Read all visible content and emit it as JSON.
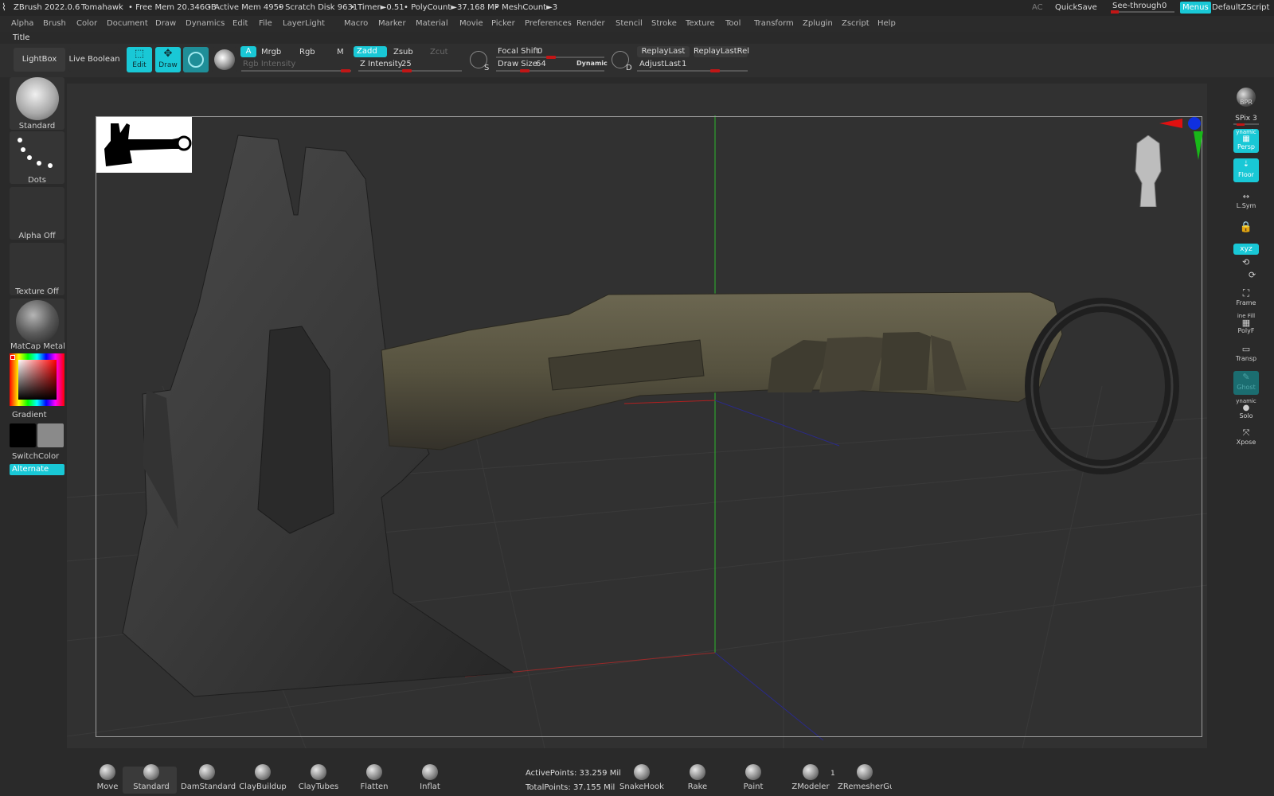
{
  "topbar": {
    "app": "ZBrush 2022.0.6",
    "doc": "Tomahawk",
    "free_mem": "• Free Mem 20.346GB",
    "active_mem": "• Active Mem 4959",
    "scratch": "• Scratch Disk 9631",
    "timer": "• Timer►0.51",
    "polycount": "• PolyCount►37.168 MP",
    "meshcount": "• MeshCount►3",
    "ac": "AC",
    "quicksave": "QuickSave",
    "see_through_label": "See-through",
    "see_through_value": "0",
    "menus": "Menus",
    "script": "DefaultZScript"
  },
  "menubar": [
    "Alpha",
    "Brush",
    "Color",
    "Document",
    "Draw",
    "Dynamics",
    "Edit",
    "File",
    "Layer",
    "Light",
    "Macro",
    "Marker",
    "Material",
    "Movie",
    "Picker",
    "Preferences",
    "Render",
    "Stencil",
    "Stroke",
    "Texture",
    "Tool",
    "Transform",
    "Zplugin",
    "Zscript",
    "Help"
  ],
  "titlebar": {
    "title": "Title"
  },
  "toolbar": {
    "lightbox": "LightBox",
    "live_boolean": "Live Boolean",
    "edit": "Edit",
    "draw": "Draw",
    "a": "A",
    "mrgb": "Mrgb",
    "rgb": "Rgb",
    "m": "M",
    "rgb_intensity": "Rgb Intensity",
    "zadd": "Zadd",
    "zsub": "Zsub",
    "zcut": "Zcut",
    "z_intensity_label": "Z Intensity",
    "z_intensity_value": "25",
    "focal_shift_label": "Focal Shift",
    "focal_shift_value": "0",
    "draw_size_label": "Draw Size",
    "draw_size_value": "64",
    "dynamic": "Dynamic",
    "replay_last": "ReplayLast",
    "replay_last_rel": "ReplayLastRel",
    "adjust_last_label": "AdjustLast",
    "adjust_last_value": "1",
    "s": "S",
    "d": "D"
  },
  "leftshelf": {
    "brush": "Standard",
    "stroke": "Dots",
    "alpha": "Alpha Off",
    "texture": "Texture Off",
    "material": "MatCap MetalC",
    "gradient": "Gradient",
    "switch_color": "SwitchColor",
    "alternate": "Alternate"
  },
  "rightshelf": {
    "bpr": "BPR",
    "spix_label": "SPix",
    "spix_value": "3",
    "dynamic": "ynamic",
    "persp": "Persp",
    "floor": "Floor",
    "lsym": "L.Sym",
    "xyz": "xyz",
    "frame": "Frame",
    "line_fill": "ine Fill",
    "polyf": "PolyF",
    "transp": "Transp",
    "ghost": "Ghost",
    "dynamic2": "ynamic",
    "solo": "Solo",
    "xpose": "Xpose"
  },
  "bottombar": {
    "brushes": [
      "Move",
      "Standard",
      "DamStandard",
      "ClayBuildup",
      "ClayTubes",
      "Flatten",
      "Inflat"
    ],
    "active_points": "ActivePoints: 33.259 Mil",
    "total_points": "TotalPoints: 37.155 Mil",
    "tools": [
      "SnakeHook",
      "Rake",
      "Paint",
      "ZModeler",
      "ZRemesherGuic"
    ],
    "zmodeler_count": "1"
  },
  "colors": {
    "accent": "#19c8d6",
    "slider_knob": "#c21616",
    "handle": "#56523f",
    "blade": "#3c3c3c"
  }
}
